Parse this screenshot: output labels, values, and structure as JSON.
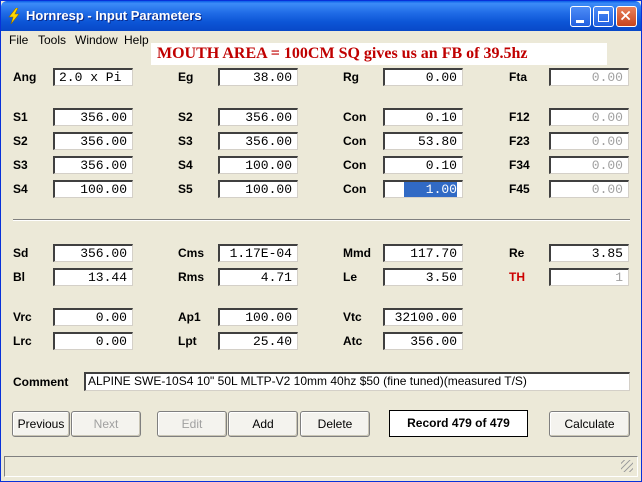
{
  "window": {
    "title": "Hornresp - Input Parameters",
    "colors": {
      "title_bar": "#0a5fe8",
      "banner_text": "#c00000",
      "th_label": "#cc0000",
      "selection": "#316ac5"
    }
  },
  "menu": [
    "File",
    "Tools",
    "Window",
    "Help"
  ],
  "banner": "MOUTH AREA = 100CM SQ gives us an FB of 39.5hz",
  "fields": {
    "ang": {
      "label": "Ang",
      "value": "2.0 x Pi"
    },
    "eg": {
      "label": "Eg",
      "value": "38.00"
    },
    "rg": {
      "label": "Rg",
      "value": "0.00"
    },
    "fta": {
      "label": "Fta",
      "value": "0.00"
    },
    "s1": {
      "label": "S1",
      "value": "356.00"
    },
    "s2a": {
      "label": "S2",
      "value": "356.00"
    },
    "s3a": {
      "label": "S3",
      "value": "356.00"
    },
    "s4a": {
      "label": "S4",
      "value": "100.00"
    },
    "s2b": {
      "label": "S2",
      "value": "356.00"
    },
    "s3b": {
      "label": "S3",
      "value": "356.00"
    },
    "s4b": {
      "label": "S4",
      "value": "100.00"
    },
    "s5": {
      "label": "S5",
      "value": "100.00"
    },
    "con1": {
      "label": "Con",
      "value": "0.10"
    },
    "con2": {
      "label": "Con",
      "value": "53.80"
    },
    "con3": {
      "label": "Con",
      "value": "0.10"
    },
    "con4": {
      "label": "Con",
      "value": "1.00"
    },
    "f12": {
      "label": "F12",
      "value": "0.00"
    },
    "f23": {
      "label": "F23",
      "value": "0.00"
    },
    "f34": {
      "label": "F34",
      "value": "0.00"
    },
    "f45": {
      "label": "F45",
      "value": "0.00"
    },
    "sd": {
      "label": "Sd",
      "value": "356.00"
    },
    "bl": {
      "label": "Bl",
      "value": "13.44"
    },
    "cms": {
      "label": "Cms",
      "value": "1.17E-04"
    },
    "rms": {
      "label": "Rms",
      "value": "4.71"
    },
    "mmd": {
      "label": "Mmd",
      "value": "117.70"
    },
    "le": {
      "label": "Le",
      "value": "3.50"
    },
    "re": {
      "label": "Re",
      "value": "3.85"
    },
    "th": {
      "label": "TH",
      "value": "1"
    },
    "vrc": {
      "label": "Vrc",
      "value": "0.00"
    },
    "lrc": {
      "label": "Lrc",
      "value": "0.00"
    },
    "ap1": {
      "label": "Ap1",
      "value": "100.00"
    },
    "lpt": {
      "label": "Lpt",
      "value": "25.40"
    },
    "vtc": {
      "label": "Vtc",
      "value": "32100.00"
    },
    "atc": {
      "label": "Atc",
      "value": "356.00"
    }
  },
  "comment": {
    "label": "Comment",
    "value": "ALPINE SWE-10S4 10\" 50L MLTP-V2 10mm 40hz $50 (fine tuned)(measured T/S)"
  },
  "buttons": {
    "previous": "Previous",
    "next": "Next",
    "edit": "Edit",
    "add": "Add",
    "delete": "Delete",
    "calculate": "Calculate"
  },
  "record": "Record 479 of 479"
}
